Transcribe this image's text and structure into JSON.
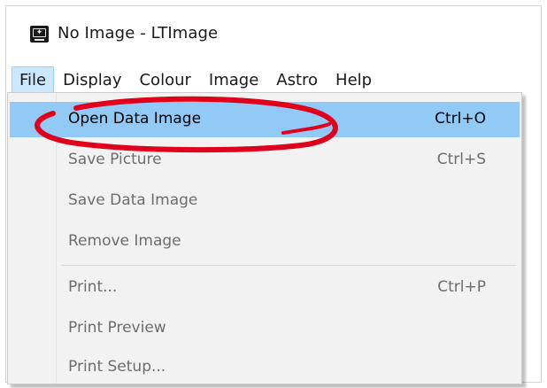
{
  "window": {
    "title": "No Image - LTImage",
    "icon": "app-monitor-icon"
  },
  "menubar": {
    "items": [
      {
        "label": "File",
        "active": true
      },
      {
        "label": "Display"
      },
      {
        "label": "Colour"
      },
      {
        "label": "Image"
      },
      {
        "label": "Astro"
      },
      {
        "label": "Help"
      }
    ]
  },
  "file_menu": {
    "items": [
      {
        "label": "Open Data Image",
        "shortcut": "Ctrl+O",
        "highlighted": true,
        "enabled": true
      },
      {
        "label": "Save Picture",
        "shortcut": "Ctrl+S",
        "enabled": false
      },
      {
        "label": "Save Data Image",
        "shortcut": "",
        "enabled": false
      },
      {
        "label": "Remove Image",
        "shortcut": "",
        "enabled": false
      },
      {
        "label": "Print...",
        "shortcut": "Ctrl+P",
        "enabled": false
      },
      {
        "label": "Print Preview",
        "shortcut": "",
        "enabled": false
      },
      {
        "label": "Print Setup...",
        "shortcut": "",
        "enabled": false
      }
    ]
  },
  "annotation": {
    "shape": "hand-drawn-ellipse",
    "color": "#e0001b",
    "target": "Open Data Image"
  },
  "colors": {
    "highlight": "#91c9f7",
    "menu_background": "#f2f2f2",
    "disabled_text": "#6d6d6d",
    "annotation_red": "#e0001b"
  }
}
